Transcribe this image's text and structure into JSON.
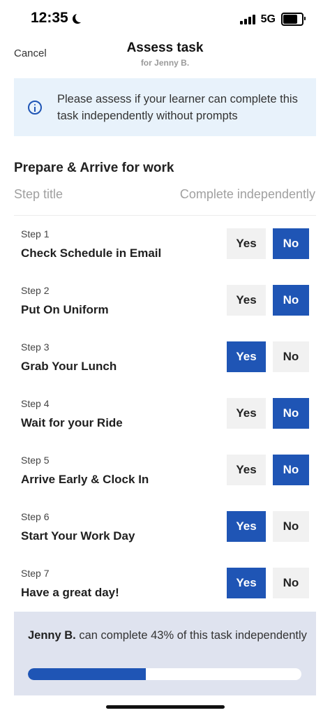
{
  "status": {
    "time": "12:35",
    "network": "5G",
    "battery_level": 0.75
  },
  "nav": {
    "cancel_label": "Cancel",
    "title": "Assess task",
    "subtitle": "for Jenny B."
  },
  "info": {
    "text": "Please assess if your learner can complete this task independently without prompts"
  },
  "section": {
    "title": "Prepare & Arrive for work",
    "col_left": "Step title",
    "col_right": "Complete independently"
  },
  "buttons": {
    "yes": "Yes",
    "no": "No"
  },
  "steps": [
    {
      "number": "Step 1",
      "title": "Check Schedule in Email",
      "answer": "no"
    },
    {
      "number": "Step 2",
      "title": "Put On Uniform",
      "answer": "no"
    },
    {
      "number": "Step 3",
      "title": "Grab Your Lunch",
      "answer": "yes"
    },
    {
      "number": "Step 4",
      "title": "Wait for your Ride",
      "answer": "no"
    },
    {
      "number": "Step 5",
      "title": "Arrive Early & Clock In",
      "answer": "no"
    },
    {
      "number": "Step 6",
      "title": "Start Your Work Day",
      "answer": "yes"
    },
    {
      "number": "Step 7",
      "title": "Have a great day!",
      "answer": "yes"
    }
  ],
  "summary": {
    "name": "Jenny B.",
    "text": " can complete 43% of this task independently",
    "progress": 0.43
  },
  "colors": {
    "accent": "#1f55b5",
    "info_bg": "#e8f2fb",
    "summary_bg": "#dfe3ef"
  },
  "icons": {
    "info": "info-circle-icon",
    "moon": "moon-icon"
  }
}
